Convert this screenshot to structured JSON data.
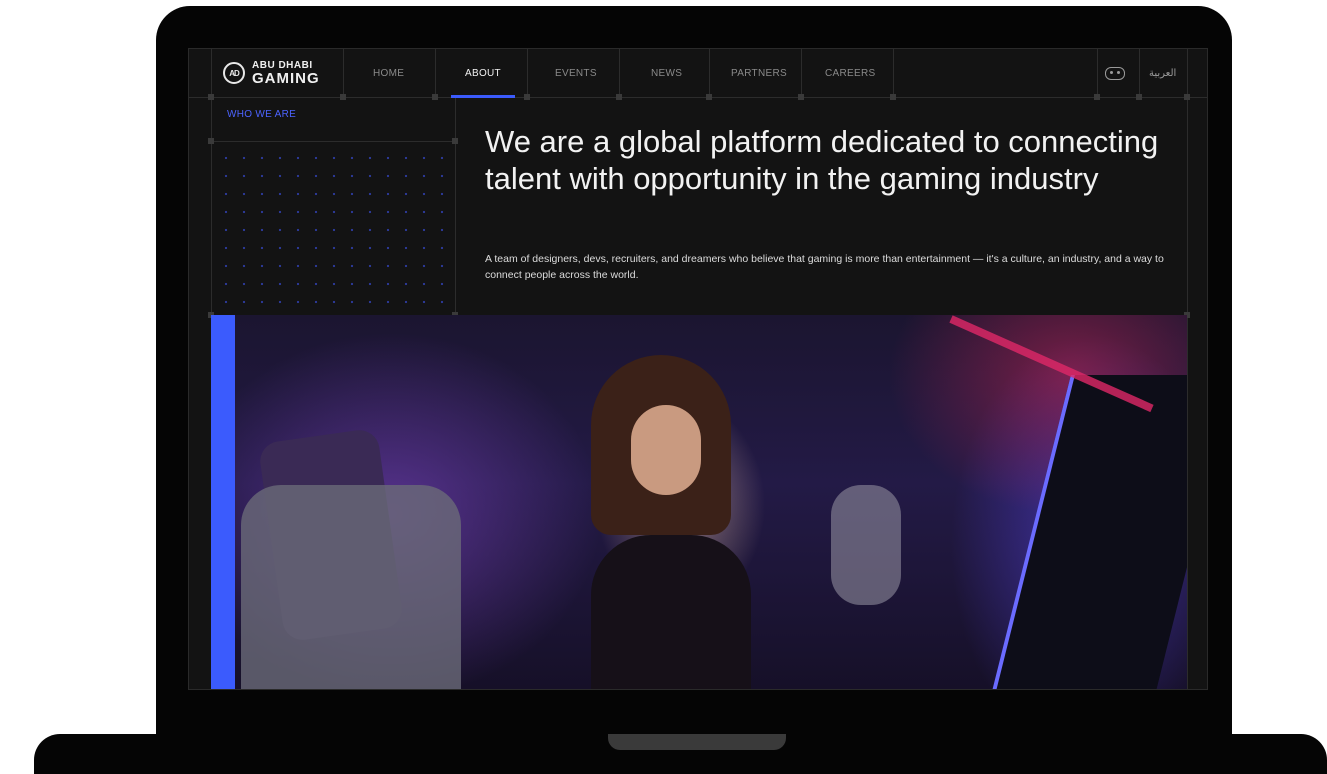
{
  "nav": {
    "logo_line1": "ABU DHABI",
    "logo_line2": "GAMING",
    "logo_mark": "AD",
    "items": [
      {
        "label": "HOME",
        "active": false
      },
      {
        "label": "ABOUT",
        "active": true
      },
      {
        "label": "EVENTS",
        "active": false
      },
      {
        "label": "NEWS",
        "active": false
      },
      {
        "label": "PARTNERS",
        "active": false
      },
      {
        "label": "CAREERS",
        "active": false
      }
    ],
    "discord_icon": "discord-icon",
    "language_label": "العربية"
  },
  "hero": {
    "eyebrow": "WHO WE ARE",
    "headline": "We are a global platform dedicated to connecting talent with opportunity in the gaming industry",
    "subtext": "A team of designers, devs, recruiters, and dreamers who believe that gaming is more than entertainment — it's a culture, an industry, and a way to connect people across the world."
  },
  "colors": {
    "accent": "#3b5bfd",
    "background": "#131313",
    "text": "#f2f2f2"
  }
}
